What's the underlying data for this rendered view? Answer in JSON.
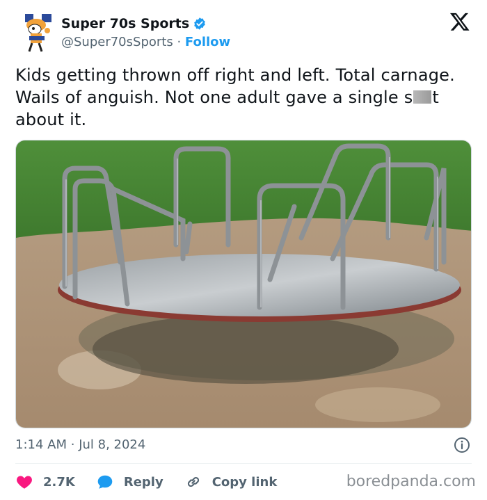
{
  "account": {
    "display_name": "Super 70s Sports",
    "handle": "@Super70sSports",
    "separator": "·",
    "follow_label": "Follow"
  },
  "tweet": {
    "text_before": "Kids getting thrown off right and left. Total carnage. Wails of anguish. Not one adult gave a single s",
    "text_after": "t about it."
  },
  "meta": {
    "time": "1:14 AM",
    "separator": "·",
    "date": "Jul 8, 2024"
  },
  "actions": {
    "likes": "2.7K",
    "reply_label": "Reply",
    "copy_link_label": "Copy link"
  },
  "watermark": "boredpanda.com",
  "icons": {
    "avatar": "avatar-illustration",
    "verified": "verified-badge-icon",
    "logo": "x-logo-icon",
    "info": "info-icon",
    "like": "heart-icon",
    "reply": "speech-bubble-icon",
    "copy": "link-icon"
  },
  "colors": {
    "accent": "#1d9bf0",
    "like": "#f91880",
    "text": "#0f1419",
    "muted": "#536471"
  }
}
